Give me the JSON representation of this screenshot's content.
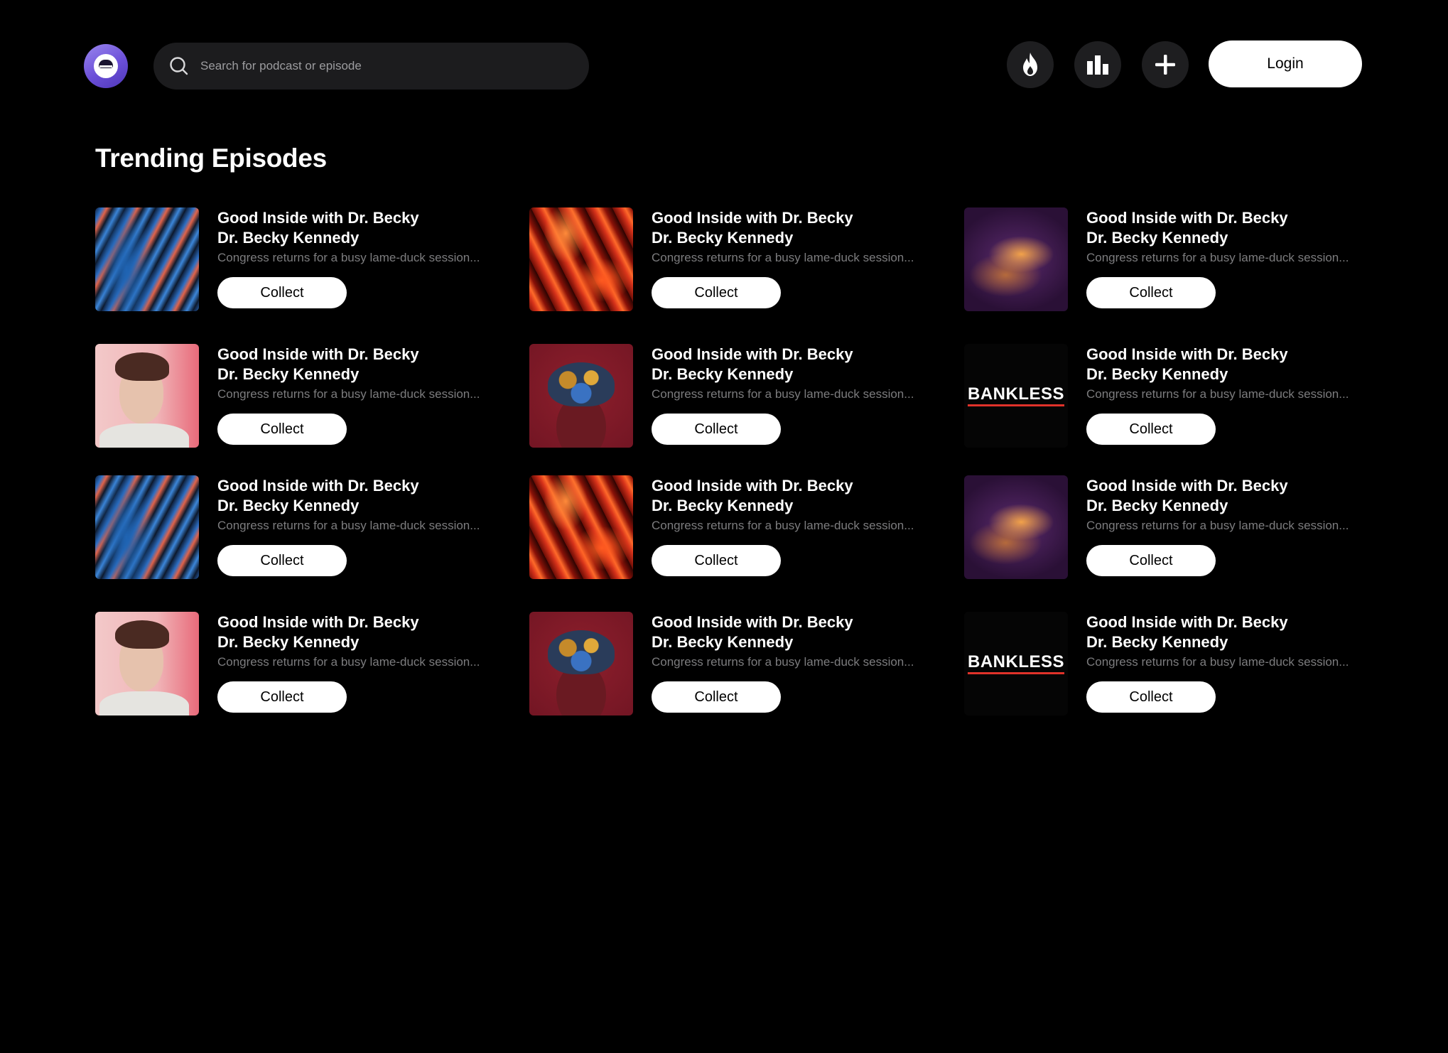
{
  "header": {
    "search": {
      "placeholder": "Search for podcast or episode",
      "value": ""
    },
    "icons": [
      "fire-icon",
      "bar-chart-icon",
      "plus-icon"
    ],
    "login_label": "Login"
  },
  "section": {
    "title": "Trending Episodes"
  },
  "colors": {
    "background": "#000000",
    "accent": "#6b4fd8",
    "button": "#ffffff",
    "muted_text": "#7c7c7e"
  },
  "episodes": [
    {
      "title": "Good Inside with Dr. Becky",
      "author": "Dr. Becky Kennedy",
      "description": "Congress returns for a busy lame-duck session...",
      "button": "Collect",
      "artwork": "abstract-blue-swirl"
    },
    {
      "title": "Good Inside with Dr. Becky",
      "author": "Dr. Becky Kennedy",
      "description": "Congress returns for a busy lame-duck session...",
      "button": "Collect",
      "artwork": "abstract-red-fire"
    },
    {
      "title": "Good Inside with Dr. Becky",
      "author": "Dr. Becky Kennedy",
      "description": "Congress returns for a busy lame-duck session...",
      "button": "Collect",
      "artwork": "abstract-purple-smoke"
    },
    {
      "title": "Good Inside with Dr. Becky",
      "author": "Dr. Becky Kennedy",
      "description": "Congress returns for a busy lame-duck session...",
      "button": "Collect",
      "artwork": "portrait-man-pink"
    },
    {
      "title": "Good Inside with Dr. Becky",
      "author": "Dr. Becky Kennedy",
      "description": "Congress returns for a busy lame-duck session...",
      "button": "Collect",
      "artwork": "crowned-figure-red"
    },
    {
      "title": "Good Inside with Dr. Becky",
      "author": "Dr. Becky Kennedy",
      "description": "Congress returns for a busy lame-duck session...",
      "button": "Collect",
      "artwork": "bankless-logo",
      "artwork_text": "BANKLESS"
    },
    {
      "title": "Good Inside with Dr. Becky",
      "author": "Dr. Becky Kennedy",
      "description": "Congress returns for a busy lame-duck session...",
      "button": "Collect",
      "artwork": "abstract-blue-swirl"
    },
    {
      "title": "Good Inside with Dr. Becky",
      "author": "Dr. Becky Kennedy",
      "description": "Congress returns for a busy lame-duck session...",
      "button": "Collect",
      "artwork": "abstract-red-fire"
    },
    {
      "title": "Good Inside with Dr. Becky",
      "author": "Dr. Becky Kennedy",
      "description": "Congress returns for a busy lame-duck session...",
      "button": "Collect",
      "artwork": "abstract-purple-smoke"
    },
    {
      "title": "Good Inside with Dr. Becky",
      "author": "Dr. Becky Kennedy",
      "description": "Congress returns for a busy lame-duck session...",
      "button": "Collect",
      "artwork": "portrait-man-pink"
    },
    {
      "title": "Good Inside with Dr. Becky",
      "author": "Dr. Becky Kennedy",
      "description": "Congress returns for a busy lame-duck session...",
      "button": "Collect",
      "artwork": "crowned-figure-red"
    },
    {
      "title": "Good Inside with Dr. Becky",
      "author": "Dr. Becky Kennedy",
      "description": "Congress returns for a busy lame-duck session...",
      "button": "Collect",
      "artwork": "bankless-logo",
      "artwork_text": "BANKLESS"
    }
  ]
}
